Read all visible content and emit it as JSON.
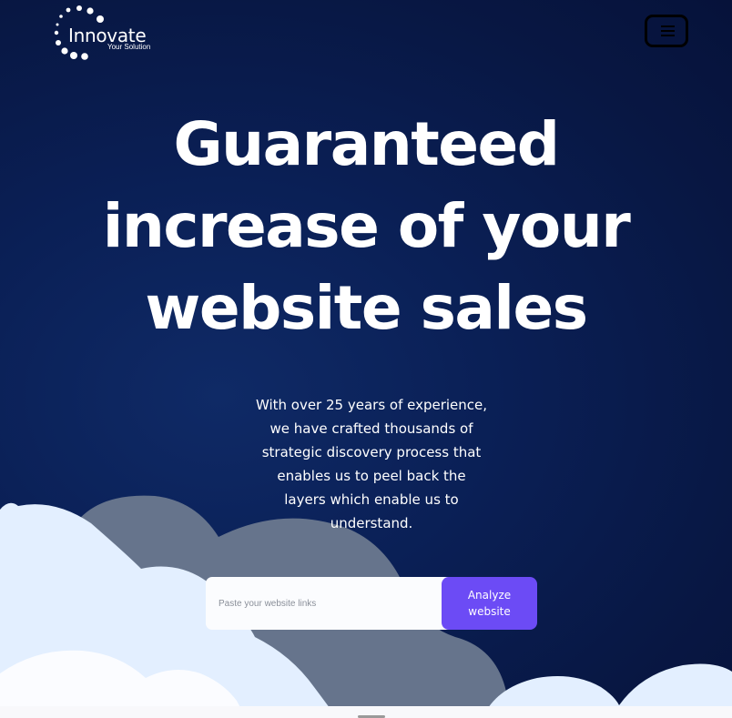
{
  "header": {
    "logo_name": "Innovate",
    "logo_tagline": "Your Solution",
    "menu_icon": "hamburger-menu-icon"
  },
  "hero": {
    "headline_lines": [
      "Guaranteed",
      "increase of your",
      "website sales"
    ],
    "description_lines": [
      "With over 25 years of experience,",
      "we have crafted thousands of",
      "strategic discovery process that",
      "enables us to peel back the",
      "layers which enable us to",
      "understand."
    ]
  },
  "form": {
    "placeholder": "Paste your website links",
    "button_label": "Analyze website"
  },
  "colors": {
    "background": "#0a1f55",
    "accent": "#6c4bf5",
    "cloud_light": "#e3efff",
    "cloud_dark": "#66748c"
  }
}
